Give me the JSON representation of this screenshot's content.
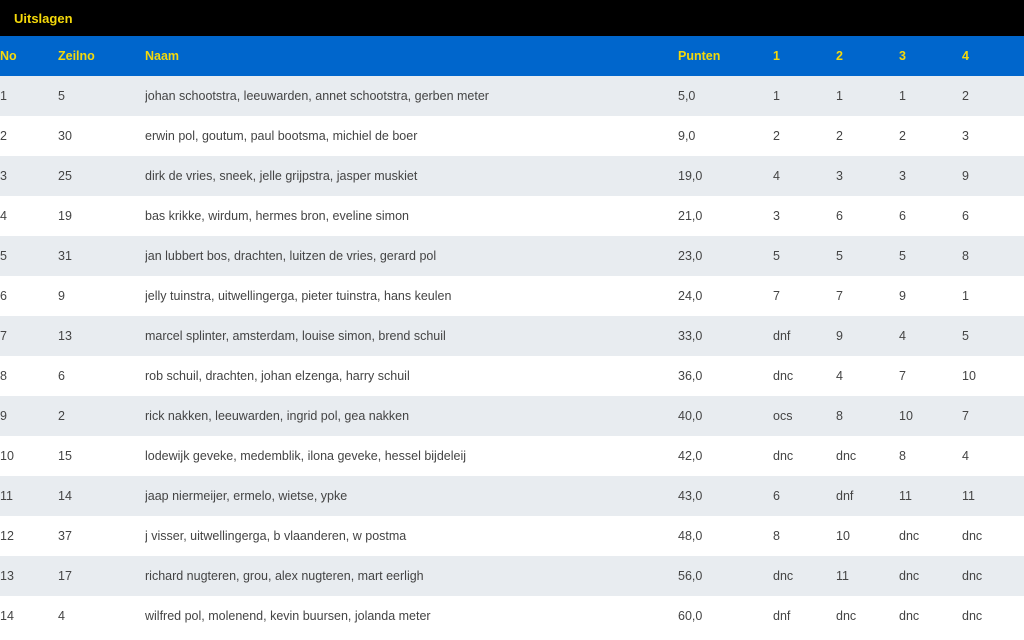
{
  "header": {
    "title": "Uitslagen"
  },
  "colors": {
    "header_bg": "#000000",
    "title": "#f5d90a",
    "table_header_bg": "#0066cc",
    "row_alt": "#e8ecf0"
  },
  "table": {
    "columns": [
      "No",
      "Zeilno",
      "Naam",
      "Punten",
      "1",
      "2",
      "3",
      "4"
    ],
    "rows": [
      [
        "1",
        "5",
        "johan schootstra, leeuwarden, annet schootstra, gerben meter",
        "5,0",
        "1",
        "1",
        "1",
        "2"
      ],
      [
        "2",
        "30",
        "erwin pol, goutum, paul bootsma, michiel de boer",
        "9,0",
        "2",
        "2",
        "2",
        "3"
      ],
      [
        "3",
        "25",
        "dirk de vries, sneek, jelle grijpstra, jasper muskiet",
        "19,0",
        "4",
        "3",
        "3",
        "9"
      ],
      [
        "4",
        "19",
        "bas krikke, wirdum, hermes bron, eveline simon",
        "21,0",
        "3",
        "6",
        "6",
        "6"
      ],
      [
        "5",
        "31",
        "jan lubbert bos, drachten, luitzen de vries, gerard pol",
        "23,0",
        "5",
        "5",
        "5",
        "8"
      ],
      [
        "6",
        "9",
        "jelly tuinstra, uitwellingerga, pieter tuinstra, hans keulen",
        "24,0",
        "7",
        "7",
        "9",
        "1"
      ],
      [
        "7",
        "13",
        "marcel splinter, amsterdam, louise simon, brend schuil",
        "33,0",
        "dnf",
        "9",
        "4",
        "5"
      ],
      [
        "8",
        "6",
        "rob schuil, drachten, johan elzenga, harry schuil",
        "36,0",
        "dnc",
        "4",
        "7",
        "10"
      ],
      [
        "9",
        "2",
        "rick nakken, leeuwarden, ingrid pol, gea nakken",
        "40,0",
        "ocs",
        "8",
        "10",
        "7"
      ],
      [
        "10",
        "15",
        "lodewijk geveke, medemblik, ilona geveke, hessel bijdeleij",
        "42,0",
        "dnc",
        "dnc",
        "8",
        "4"
      ],
      [
        "11",
        "14",
        "jaap niermeijer, ermelo, wietse, ypke",
        "43,0",
        "6",
        "dnf",
        "11",
        "11"
      ],
      [
        "12",
        "37",
        "j visser, uitwellingerga, b vlaanderen, w postma",
        "48,0",
        "8",
        "10",
        "dnc",
        "dnc"
      ],
      [
        "13",
        "17",
        "richard nugteren, grou, alex nugteren, mart eerligh",
        "56,0",
        "dnc",
        "11",
        "dnc",
        "dnc"
      ],
      [
        "14",
        "4",
        "wilfred pol, molenend, kevin buursen, jolanda meter",
        "60,0",
        "dnf",
        "dnc",
        "dnc",
        "dnc"
      ]
    ]
  }
}
